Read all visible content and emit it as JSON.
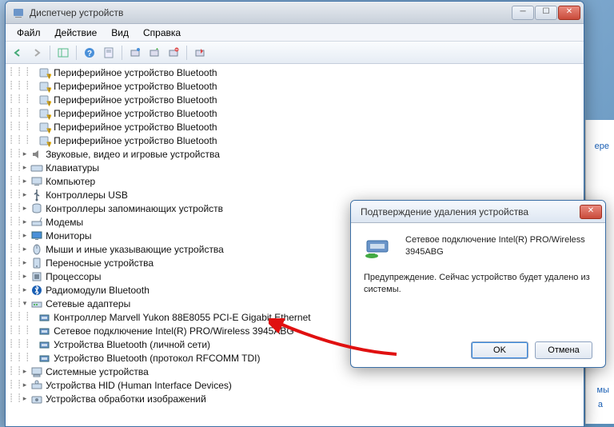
{
  "window": {
    "title": "Диспетчер устройств",
    "menus": [
      "Файл",
      "Действие",
      "Вид",
      "Справка"
    ]
  },
  "tree": [
    {
      "indent": 3,
      "icon": "bt-warn",
      "label": "Периферийное устройство Bluetooth"
    },
    {
      "indent": 3,
      "icon": "bt-warn",
      "label": "Периферийное устройство Bluetooth"
    },
    {
      "indent": 3,
      "icon": "bt-warn",
      "label": "Периферийное устройство Bluetooth"
    },
    {
      "indent": 3,
      "icon": "bt-warn",
      "label": "Периферийное устройство Bluetooth"
    },
    {
      "indent": 3,
      "icon": "bt-warn",
      "label": "Периферийное устройство Bluetooth"
    },
    {
      "indent": 3,
      "icon": "bt-warn",
      "label": "Периферийное устройство Bluetooth"
    },
    {
      "indent": 2,
      "icon": "audio",
      "expander": "+",
      "label": "Звуковые, видео и игровые устройства"
    },
    {
      "indent": 2,
      "icon": "keyboard",
      "expander": "+",
      "label": "Клавиатуры"
    },
    {
      "indent": 2,
      "icon": "computer",
      "expander": "+",
      "label": "Компьютер"
    },
    {
      "indent": 2,
      "icon": "usb",
      "expander": "+",
      "label": "Контроллеры USB"
    },
    {
      "indent": 2,
      "icon": "storage",
      "expander": "+",
      "label": "Контроллеры запоминающих устройств"
    },
    {
      "indent": 2,
      "icon": "modem",
      "expander": "+",
      "label": "Модемы"
    },
    {
      "indent": 2,
      "icon": "monitor",
      "expander": "+",
      "label": "Мониторы"
    },
    {
      "indent": 2,
      "icon": "mouse",
      "expander": "+",
      "label": "Мыши и иные указывающие устройства"
    },
    {
      "indent": 2,
      "icon": "portable",
      "expander": "+",
      "label": "Переносные устройства"
    },
    {
      "indent": 2,
      "icon": "cpu",
      "expander": "+",
      "label": "Процессоры"
    },
    {
      "indent": 2,
      "icon": "bt",
      "expander": "+",
      "label": "Радиомодули Bluetooth"
    },
    {
      "indent": 2,
      "icon": "network",
      "expander": "-",
      "label": "Сетевые адаптеры"
    },
    {
      "indent": 3,
      "icon": "nic",
      "label": "Контроллер Marvell Yukon 88E8055 PCI-E Gigabit Ethernet"
    },
    {
      "indent": 3,
      "icon": "nic",
      "label": "Сетевое подключение Intel(R) PRO/Wireless 3945ABG"
    },
    {
      "indent": 3,
      "icon": "nic",
      "label": "Устройства Bluetooth (личной сети)"
    },
    {
      "indent": 3,
      "icon": "nic",
      "label": "Устройство Bluetooth (протокол RFCOMM TDI)"
    },
    {
      "indent": 2,
      "icon": "system",
      "expander": "+",
      "label": "Системные устройства"
    },
    {
      "indent": 2,
      "icon": "hid",
      "expander": "+",
      "label": "Устройства HID (Human Interface Devices)"
    },
    {
      "indent": 2,
      "icon": "imaging",
      "expander": "+",
      "label": "Устройства обработки изображений"
    }
  ],
  "dialog": {
    "title": "Подтверждение удаления устройства",
    "device": "Сетевое подключение Intel(R) PRO/Wireless 3945ABG",
    "warning": "Предупреждение. Сейчас устройство будет удалено из системы.",
    "ok": "OK",
    "cancel": "Отмена"
  },
  "bg": {
    "t1": "ере",
    "t2": "мы",
    "t3": "а"
  }
}
